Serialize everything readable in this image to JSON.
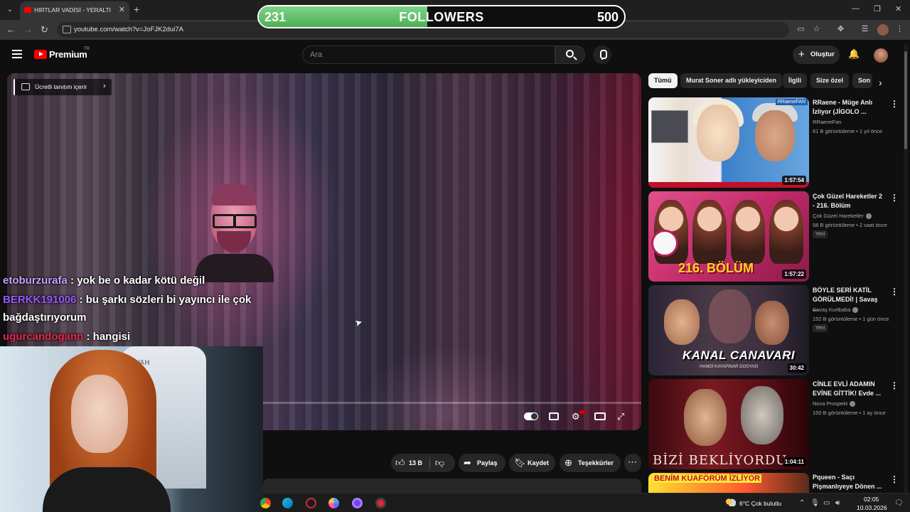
{
  "browser": {
    "tab_title": "HIRTLAR VADİSİ - YERALTI DİZİ",
    "url": "youtube.com/watch?v=JoFJK2dui7A",
    "new_tab": "+",
    "tab_close": "✕",
    "win_min": "—",
    "win_max": "❐",
    "win_close": "✕"
  },
  "overlay": {
    "followers_current": "231",
    "followers_label": "FOLLOWERS",
    "followers_goal": "500",
    "followers_progress": 0.462
  },
  "header": {
    "brand": "Premium",
    "region": "TR",
    "search_placeholder": "Ara",
    "create_label": "Oluştur"
  },
  "player": {
    "promo_label": "Ücretli tanıtım içerir"
  },
  "chat": [
    {
      "user": "etoburzurafa",
      "sep": " : ",
      "message": "yok be o kadar kötü değil"
    },
    {
      "user": "BERKK191006",
      "sep": " : ",
      "message": "bu şarkı sözleri bi yayıncı ile çok bağdaştırıyorum"
    },
    {
      "user": "ugurcandogann",
      "sep": " : ",
      "message": "hangisi"
    }
  ],
  "webcam": {
    "chair_text": "NWAH"
  },
  "actions": {
    "likes": "13 B",
    "share": "Paylaş",
    "save": "Kaydet",
    "thanks": "Teşekkürler"
  },
  "chips": [
    "Tümü",
    "Murat Soner adlı yükleyiciden",
    "İlgili",
    "Size özel",
    "Son"
  ],
  "recommendations": [
    {
      "title": "RRaene - Müge Anlı İzliyor (JİGOLO ...",
      "channel": "RRaeneFan",
      "meta": "61 B görüntüleme • 1 yıl önce",
      "duration": "1:57:54",
      "badge": "",
      "thumb_tag": "RRaeneFAN"
    },
    {
      "title": "Çok Güzel Hareketler 2 - 216. Bölüm",
      "channel": "Çok Güzel Hareketler",
      "meta": "58 B görüntüleme • 2 saat önce",
      "duration": "1:57:22",
      "badge": "Yeni",
      "thumb_text": "216. BÖLÜM"
    },
    {
      "title": "BÖYLE SERİ KATİL GÖRÜLMEDİ! | Savaş ...",
      "channel": "Savaş Kurtbaba",
      "meta": "152 B görüntüleme • 1 gün önce",
      "duration": "30:42",
      "badge": "Yeni",
      "thumb_text": "KANAL CANAVARI",
      "thumb_sub": "HAMDİ KAYAPINAR DOSYASI"
    },
    {
      "title": "CİNLE EVLİ ADAMIN EVİNE GİTTİK! Evde ...",
      "channel": "Nova Prospekt",
      "meta": "150 B görüntüleme • 1 ay önce",
      "duration": "1:04:11",
      "badge": "",
      "thumb_text": "BİZİ BEKLİYORDU"
    },
    {
      "title": "Pqueen - Saçı Pişmanlıyeye Dönen ...",
      "channel": "",
      "meta": "",
      "duration": "",
      "badge": "",
      "thumb_text": "BENİM KUAFÖRÜM İZLİYOR"
    }
  ],
  "taskbar": {
    "weather": "6°C  Çok bulutlu",
    "time": "02:05",
    "date": "10.03.2026"
  }
}
